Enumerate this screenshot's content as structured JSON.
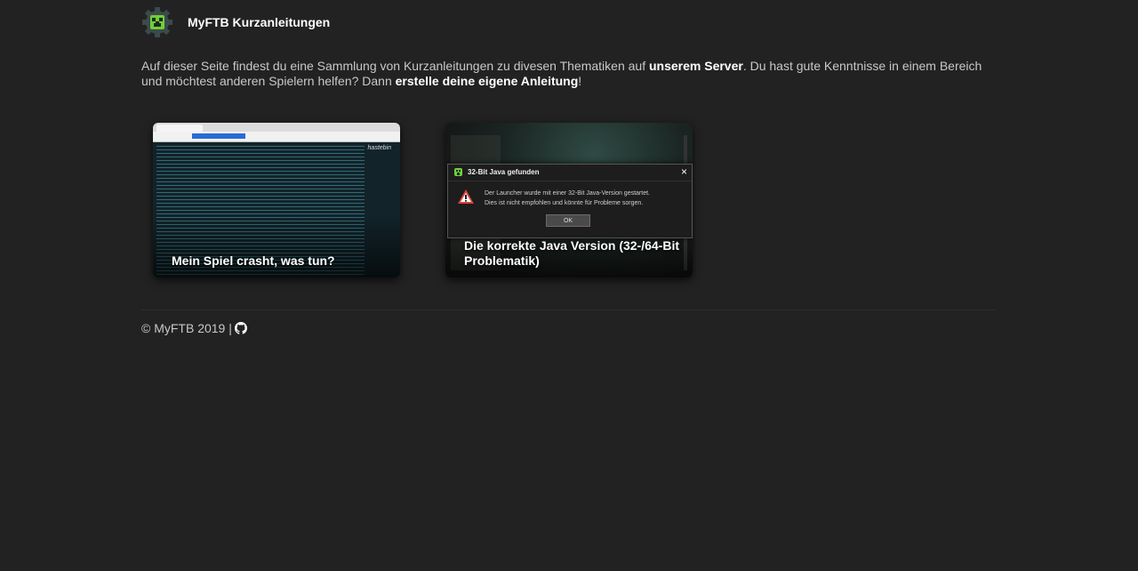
{
  "header": {
    "brand_title": "MyFTB Kurzanleitungen",
    "logo_icon": "myftb-creeper-logo-icon"
  },
  "intro": {
    "text_1": "Auf dieser Seite findest du eine Sammlung von Kurzanleitungen zu divesen Thematiken auf ",
    "server_strong": "unserem Server",
    "text_2": ". Du hast gute Kenntnisse in einem Bereich und möchtest anderen Spielern helfen? Dann ",
    "create_link": "erstelle deine eigene Anleitung",
    "text_3": "!"
  },
  "cards": [
    {
      "title": "Mein Spiel crasht, was tun?",
      "thumb_brand": "hastebin"
    },
    {
      "title": "Die korrekte Java Version (32-/64-Bit Problematik)",
      "dialog": {
        "title": "32-Bit Java gefunden",
        "message_line_1": "Der Launcher wurde mit einer 32-Bit Java-Version gestartet.",
        "message_line_2": "Dies ist nicht empfohlen und könnte für Probleme sorgen.",
        "ok_label": "OK",
        "close_glyph": "×"
      }
    }
  ],
  "footer": {
    "copyright": "© MyFTB 2019 |",
    "github_icon": "github-icon"
  },
  "colors": {
    "background": "#222222",
    "text": "#c8c8c8",
    "strong": "#ffffff",
    "warning": "#d9423a"
  }
}
